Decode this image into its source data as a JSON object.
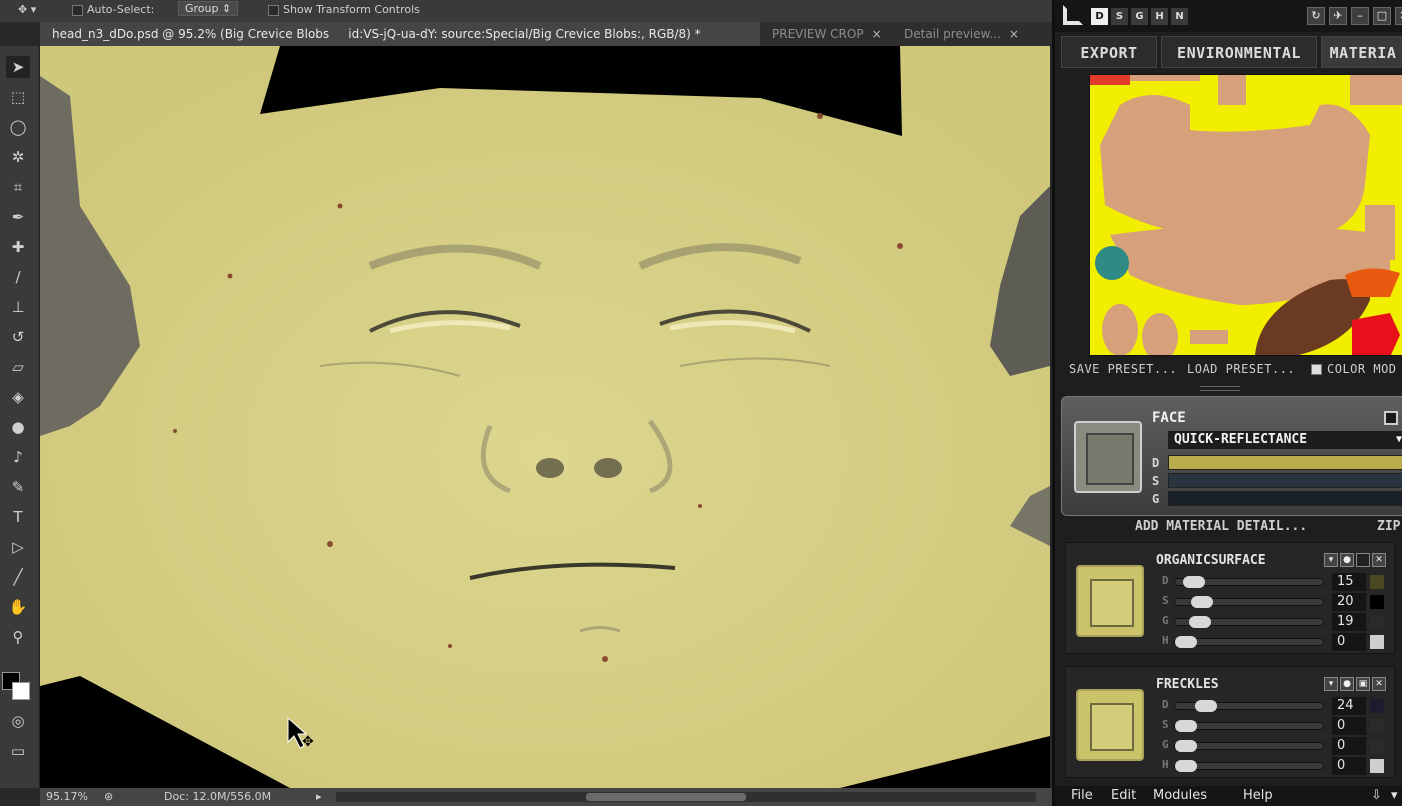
{
  "options_bar": {
    "auto_select_label": "Auto-Select:",
    "auto_select_value": "Group",
    "show_transform_label": "Show Transform Controls"
  },
  "tabs": [
    {
      "label": "head_n3_dDo.psd @ 95.2% (Big Crevice Blobs",
      "close": ""
    },
    {
      "label": "id:VS-jQ-ua-dY: source:Special/Big Crevice Blobs:, RGB/8) *",
      "close": "×"
    },
    {
      "label": "PREVIEW CROP",
      "close": "×"
    },
    {
      "label": "Detail preview...",
      "close": "×"
    }
  ],
  "status": {
    "zoom": "95.17%",
    "doc": "Doc: 12.0M/556.0M"
  },
  "ddo": {
    "modes": [
      "D",
      "S",
      "G",
      "H",
      "N"
    ],
    "tabs": [
      "EXPORT",
      "ENVIRONMENTAL",
      "MATERIA"
    ],
    "save_preset": "SAVE PRESET...",
    "load_preset": "LOAD PRESET...",
    "color_mode": "COLOR MOD",
    "face": {
      "label": "FACE",
      "preset": "QUICK-REFLECTANCE",
      "rows": [
        "D",
        "S",
        "G"
      ]
    },
    "add_material": "ADD MATERIAL DETAIL...",
    "zip": "ZIP",
    "layers": [
      {
        "name": "ORGANICSURFACE",
        "sliders": [
          {
            "label": "D",
            "value": "15",
            "swatch": "#4a4820"
          },
          {
            "label": "S",
            "value": "20",
            "swatch": "#000000"
          },
          {
            "label": "G",
            "value": "19",
            "swatch": "#2a2a2a"
          },
          {
            "label": "H",
            "value": "0",
            "swatch": "#cfcfcf"
          }
        ]
      },
      {
        "name": "FRECKLES",
        "sliders": [
          {
            "label": "D",
            "value": "24",
            "swatch": "#1c1c2e"
          },
          {
            "label": "S",
            "value": "0",
            "swatch": "#2a2a2a"
          },
          {
            "label": "G",
            "value": "0",
            "swatch": "#2a2a2a"
          },
          {
            "label": "H",
            "value": "0",
            "swatch": "#cfcfcf"
          }
        ]
      }
    ],
    "menu": [
      "File",
      "Edit",
      "Modules",
      "Help"
    ]
  }
}
